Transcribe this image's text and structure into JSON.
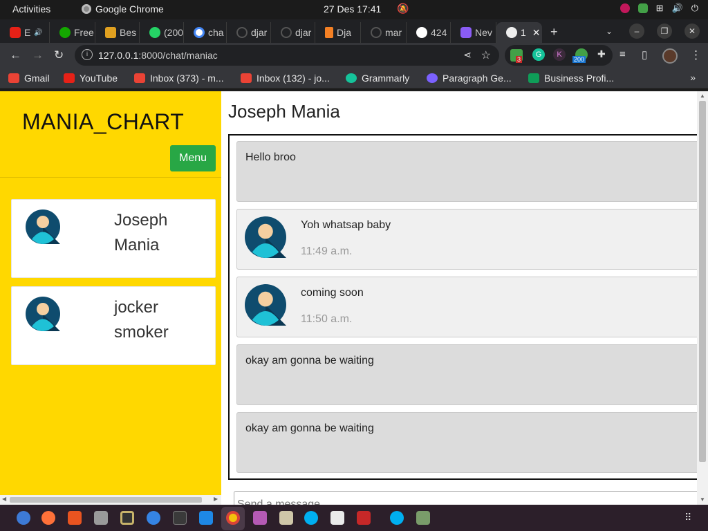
{
  "system": {
    "activities": "Activities",
    "app_name": "Google Chrome",
    "clock": "27 Des  17:41"
  },
  "tabs": [
    {
      "label": "E",
      "color": "#e62117"
    },
    {
      "label": "Free",
      "color": "#14a800"
    },
    {
      "label": "Bes",
      "color": "#e0a020"
    },
    {
      "label": "(200",
      "color": "#25d366"
    },
    {
      "label": "cha",
      "color": "#4285f4"
    },
    {
      "label": "djar",
      "color": "#333333"
    },
    {
      "label": "djar",
      "color": "#333333"
    },
    {
      "label": "Dja",
      "color": "#f48024"
    },
    {
      "label": "mar",
      "color": "#333333"
    },
    {
      "label": "424",
      "color": "#ffffff"
    },
    {
      "label": "Nev",
      "color": "#8a5cf5"
    },
    {
      "label": "1",
      "color": "#ffffff"
    }
  ],
  "browser": {
    "url_host": "127.0.0.1",
    "url_path": ":8000/chat/maniac",
    "badge_red": "3",
    "badge_blue": "200"
  },
  "bookmarks": [
    {
      "label": "Gmail",
      "color": "#ea4335"
    },
    {
      "label": "YouTube",
      "color": "#e62117"
    },
    {
      "label": "Inbox (373) - m...",
      "color": "#ea4335"
    },
    {
      "label": "Inbox (132) - jo...",
      "color": "#ea4335"
    },
    {
      "label": "Grammarly",
      "color": "#15c39a"
    },
    {
      "label": "Paragraph Ge...",
      "color": "#7b61ff"
    },
    {
      "label": "Business Profi...",
      "color": "#0f9d58"
    }
  ],
  "page": {
    "brand": "MANIA_CHART",
    "menu_label": "Menu",
    "contacts": [
      {
        "name": "Joseph Mania"
      },
      {
        "name": "jocker smoker"
      }
    ],
    "chat_title": "Joseph Mania",
    "messages": [
      {
        "text": "Hello broo",
        "time": "",
        "avatar": false
      },
      {
        "text": "Yoh whatsap baby",
        "time": "11:49 a.m.",
        "avatar": true
      },
      {
        "text": "coming soon",
        "time": "11:50 a.m.",
        "avatar": true
      },
      {
        "text": "okay am gonna be waiting",
        "time": "",
        "avatar": false
      },
      {
        "text": "okay am gonna be waiting",
        "time": "",
        "avatar": false
      }
    ],
    "send_placeholder": "Send a message"
  },
  "colors": {
    "sidebar": "#ffd800",
    "menu_button": "#28a745",
    "avatar_bg": "#0f4c6e",
    "avatar_body": "#1fc1d6",
    "avatar_skin": "#f5cfa0"
  }
}
